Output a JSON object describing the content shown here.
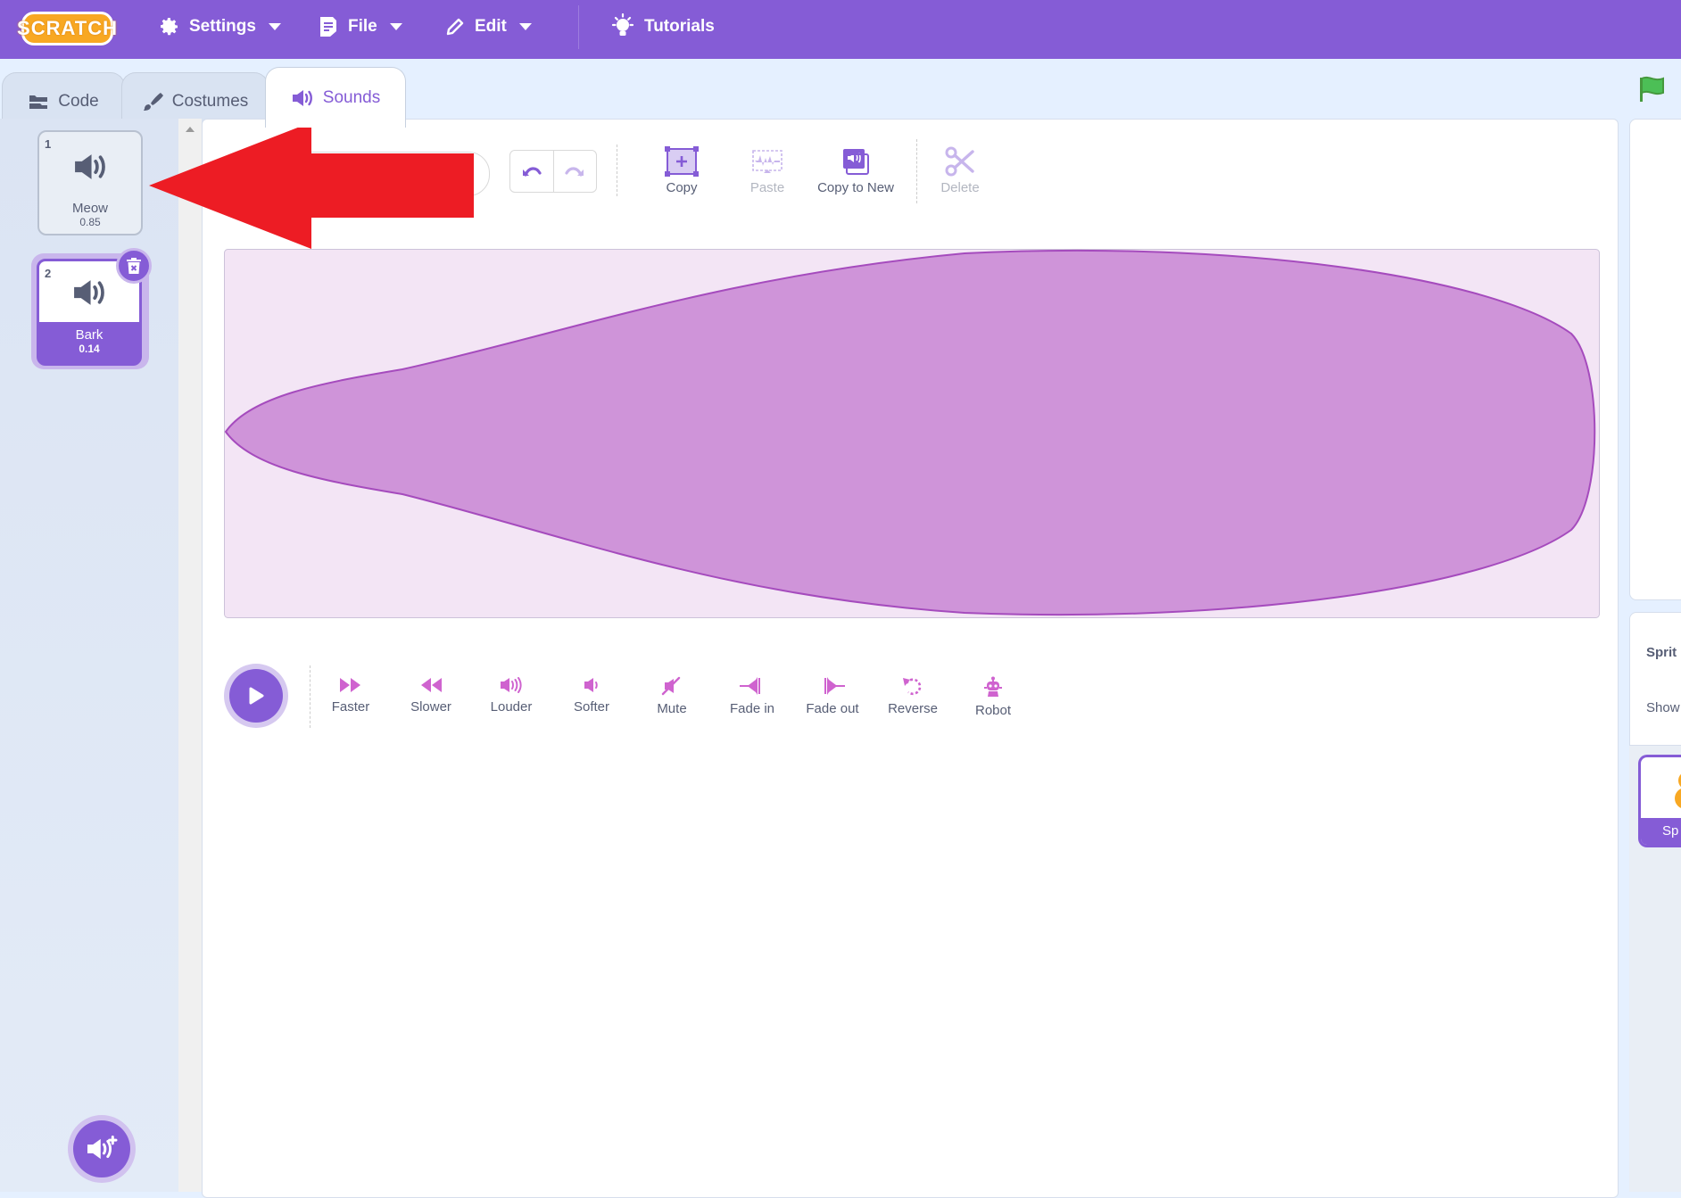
{
  "menubar": {
    "logo": "SCRATCH",
    "settings": "Settings",
    "file": "File",
    "edit": "Edit",
    "tutorials": "Tutorials"
  },
  "tabs": {
    "code": "Code",
    "costumes": "Costumes",
    "sounds": "Sounds"
  },
  "sounds": [
    {
      "index": "1",
      "name": "Meow",
      "duration": "0.85"
    },
    {
      "index": "2",
      "name": "Bark",
      "duration": "0.14"
    }
  ],
  "toolbar": {
    "copy": "Copy",
    "paste": "Paste",
    "copy_to_new": "Copy to New",
    "delete": "Delete"
  },
  "effects": [
    "Faster",
    "Slower",
    "Louder",
    "Softer",
    "Mute",
    "Fade in",
    "Fade out",
    "Reverse",
    "Robot"
  ],
  "right_panel": {
    "sprite_label": "Sprit",
    "show_label": "Show",
    "sprite_tile_label": "Sp"
  },
  "colors": {
    "menubar": "#855cd6",
    "accent": "#855cd6",
    "waveform_fill": "#cf94d9",
    "waveform_stroke": "#a54bbd",
    "annotation_arrow": "#ed1c24"
  }
}
